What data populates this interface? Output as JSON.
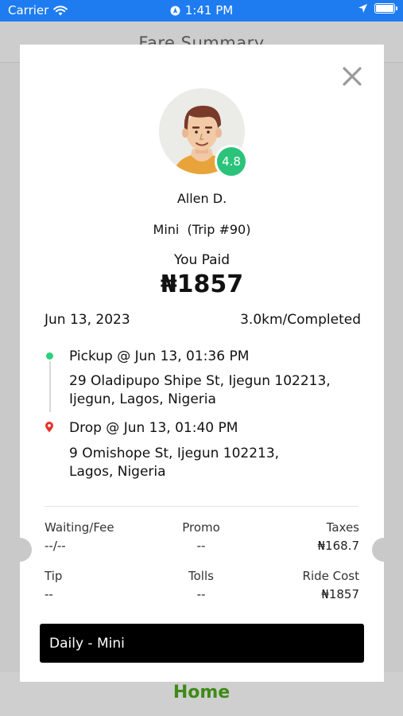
{
  "status_bar": {
    "carrier": "Carrier",
    "time": "1:41 PM"
  },
  "background": {
    "header_title": "Fare Summary",
    "home_tab_label": "Home",
    "home_color": "#3f8a18"
  },
  "card": {
    "driver": {
      "name": "Allen D.",
      "rating": "4.8"
    },
    "trip": "Mini  (Trip #90)",
    "paid_label": "You Paid",
    "amount": "₦1857",
    "date": "Jun 13, 2023",
    "distance_status": "3.0km/Completed",
    "pickup": {
      "title": "Pickup @ Jun 13, 01:36 PM",
      "address": "29 Oladipupo Shipe St, Ijegun 102213, Ijegun, Lagos, Nigeria"
    },
    "drop": {
      "title": "Drop @ Jun 13, 01:40 PM",
      "address": "9 Omishope St, Ijegun 102213, Lagos, Nigeria"
    },
    "fares": {
      "waiting_label": "Waiting/Fee",
      "waiting_value": "--/--",
      "promo_label": "Promo",
      "promo_value": "--",
      "taxes_label": "Taxes",
      "taxes_value": "₦168.7",
      "tip_label": "Tip",
      "tip_value": "--",
      "tolls_label": "Tolls",
      "tolls_value": "--",
      "ride_cost_label": "Ride Cost",
      "ride_cost_value": "₦1857"
    },
    "plan": "Daily - Mini"
  },
  "colors": {
    "status_bar": "#1e7cf0",
    "rating_badge": "#2bc37a",
    "pickup_dot": "#2bd17e",
    "drop_pin": "#e5332a"
  },
  "icons": [
    "wifi-icon",
    "location-arrow-icon",
    "battery-icon",
    "close-icon",
    "avatar-icon",
    "pickup-dot-icon",
    "drop-pin-icon"
  ]
}
